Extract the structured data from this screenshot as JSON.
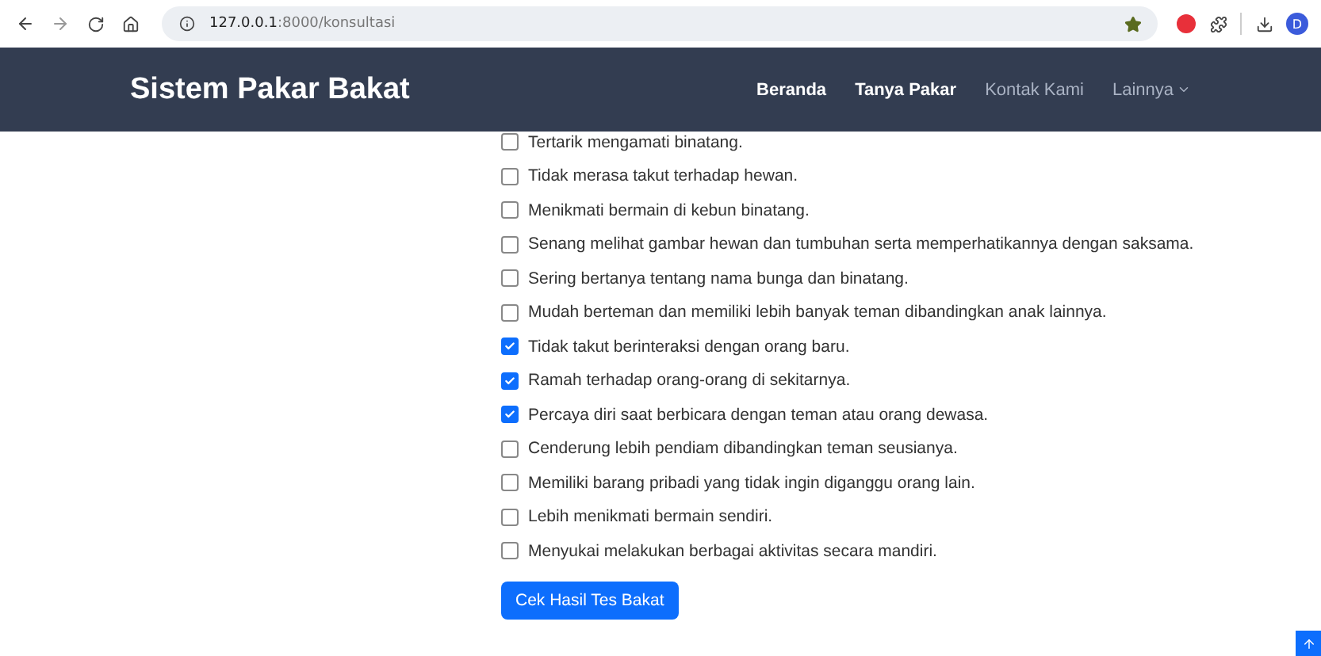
{
  "browser": {
    "url_host": "127.0.0.1",
    "url_rest": ":8000/konsultasi",
    "profile_initial": "D",
    "bookmarked": true
  },
  "navbar": {
    "brand": "Sistem Pakar Bakat",
    "links": [
      {
        "label": "Beranda",
        "selected": true,
        "kind": "link"
      },
      {
        "label": "Tanya Pakar",
        "selected": true,
        "kind": "link"
      },
      {
        "label": "Kontak Kami",
        "selected": false,
        "kind": "link"
      },
      {
        "label": "Lainnya",
        "selected": false,
        "kind": "dropdown"
      }
    ]
  },
  "questions": [
    {
      "text": "Tertarik mengamati binatang.",
      "checked": false
    },
    {
      "text": "Tidak merasa takut terhadap hewan.",
      "checked": false
    },
    {
      "text": "Menikmati bermain di kebun binatang.",
      "checked": false
    },
    {
      "text": "Senang melihat gambar hewan dan tumbuhan serta memperhatikannya dengan saksama.",
      "checked": false
    },
    {
      "text": "Sering bertanya tentang nama bunga dan binatang.",
      "checked": false
    },
    {
      "text": "Mudah berteman dan memiliki lebih banyak teman dibandingkan anak lainnya.",
      "checked": false
    },
    {
      "text": "Tidak takut berinteraksi dengan orang baru.",
      "checked": true
    },
    {
      "text": "Ramah terhadap orang-orang di sekitarnya.",
      "checked": true
    },
    {
      "text": "Percaya diri saat berbicara dengan teman atau orang dewasa.",
      "checked": true
    },
    {
      "text": "Cenderung lebih pendiam dibandingkan teman seusianya.",
      "checked": false
    },
    {
      "text": "Memiliki barang pribadi yang tidak ingin diganggu orang lain.",
      "checked": false
    },
    {
      "text": "Lebih menikmati bermain sendiri.",
      "checked": false
    },
    {
      "text": "Menyukai melakukan berbagai aktivitas secara mandiri.",
      "checked": false
    }
  ],
  "submit": {
    "label": "Cek Hasil Tes Bakat"
  }
}
